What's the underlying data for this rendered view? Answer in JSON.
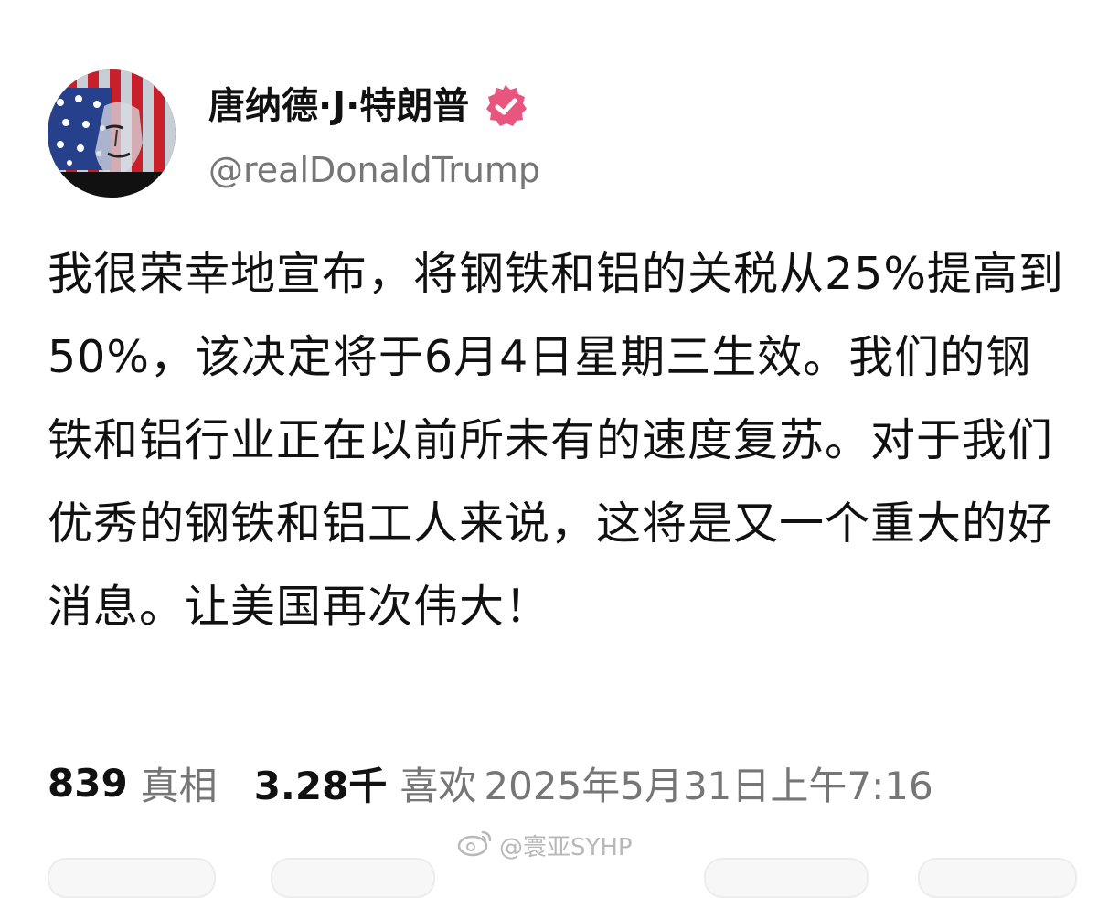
{
  "author": {
    "display_name": "唐纳德·J·特朗普",
    "handle": "@realDonaldTrump",
    "verified_badge_icon": "verified-badge-icon",
    "verified_color": "#e8567f"
  },
  "post": {
    "text": "我很荣幸地宣布，将钢铁和铝的关税从25%提高到50%，该决定将于6月4日星期三生效。我们的钢铁和铝行业正在以前所未有的速度复苏。对于我们优秀的钢铁和铝工人来说，这将是又一个重大的好消息。让美国再次伟大！"
  },
  "stats": {
    "truths_count": "839",
    "truths_label": "真相",
    "likes_count": "3.28千",
    "likes_label": "喜欢",
    "timestamp": "2025年5月31日上午7:16"
  },
  "watermark": {
    "text": "@寰亚SYHP",
    "icon": "weibo-icon"
  }
}
